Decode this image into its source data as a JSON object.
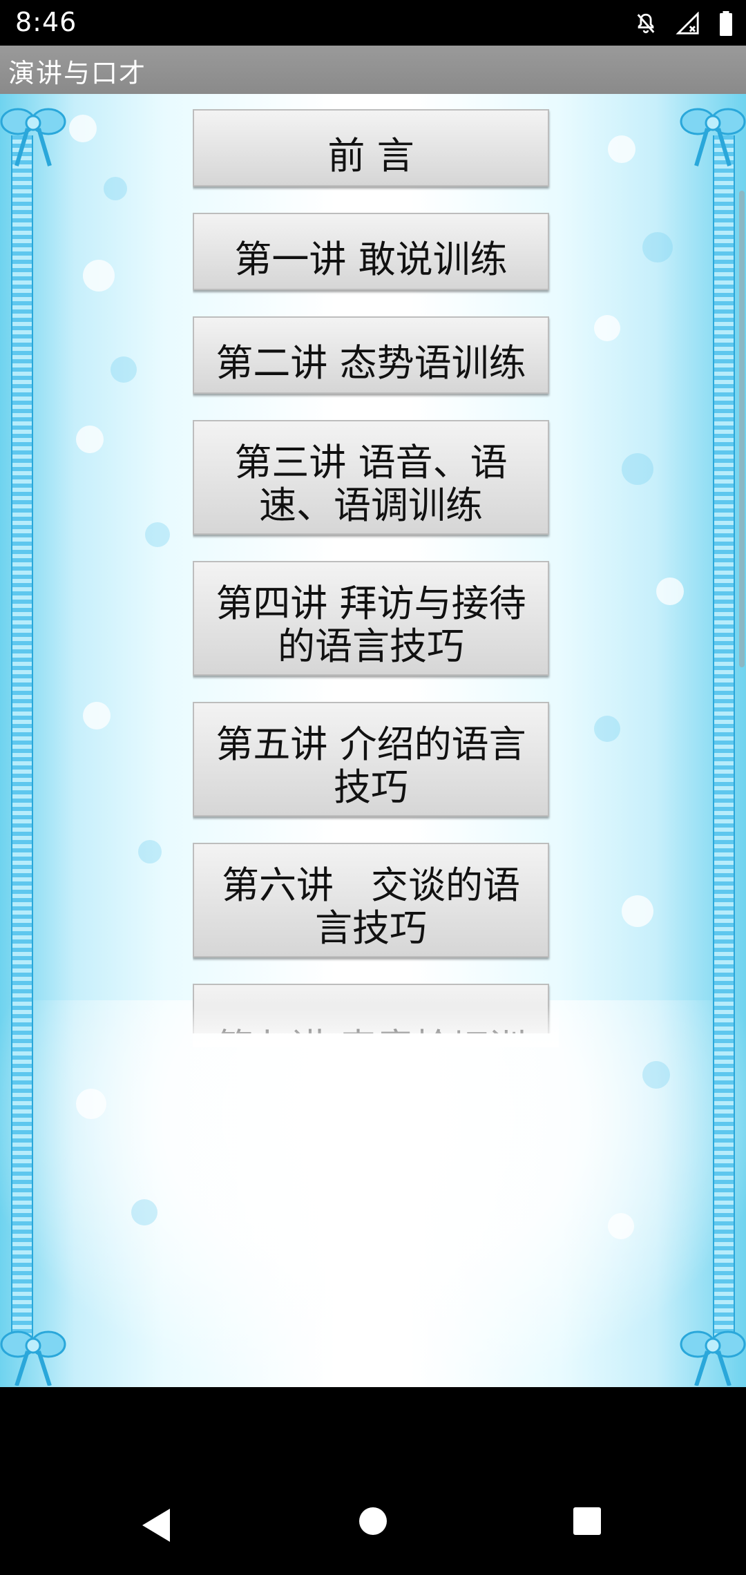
{
  "status_bar": {
    "time": "8:46",
    "icons": [
      "notifications-off-icon",
      "signal-off-icon",
      "battery-icon"
    ]
  },
  "app": {
    "title": "演讲与口才"
  },
  "menu": {
    "items": [
      {
        "label": "前 言"
      },
      {
        "label": "第一讲 敢说训练"
      },
      {
        "label": "第二讲 态势语训练"
      },
      {
        "label": "第三讲 语音、语\n速、语调训练"
      },
      {
        "label": "第四讲 拜访与接待\n的语言技巧"
      },
      {
        "label": "第五讲 介绍的语言\n技巧"
      },
      {
        "label": "第六讲　交谈的语\n言技巧"
      },
      {
        "label": "第七讲 表意恰切训"
      }
    ]
  },
  "nav": {
    "back": "back-icon",
    "home": "home-icon",
    "recents": "recents-icon"
  },
  "colors": {
    "title_bar": "#8f8f8f",
    "border_blue": "#2aa7da",
    "light_blue": "#c7effb"
  }
}
